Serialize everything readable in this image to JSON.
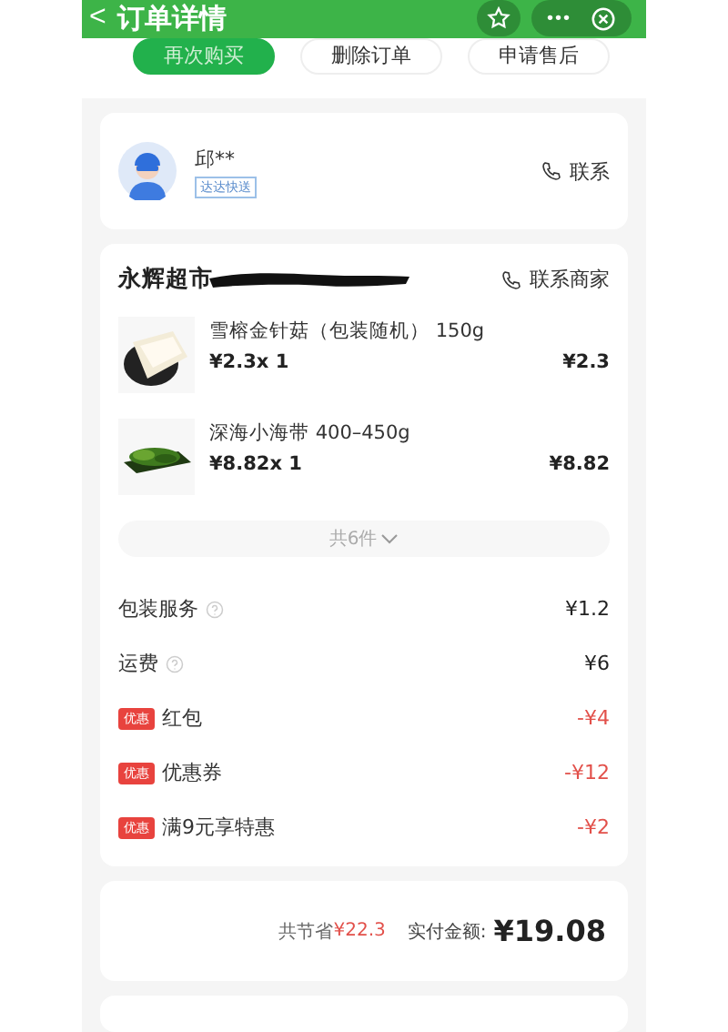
{
  "header": {
    "back": "<",
    "title": "订单详情",
    "more": "•••"
  },
  "actions": [
    {
      "label": "再次购买",
      "kind": "primary"
    },
    {
      "label": "删除订单",
      "kind": "plain"
    },
    {
      "label": "申请售后",
      "kind": "plain"
    }
  ],
  "courier": {
    "name": "邱**",
    "tag": "达达快送",
    "contact": "联系"
  },
  "store": {
    "name": "永辉超市",
    "redacted": true,
    "contact": "联系商家"
  },
  "items": [
    {
      "name": "雪榕金针菇（包装随机） 150g",
      "unit": "¥2.3x  1",
      "total": "¥2.3",
      "kind": "mushroom"
    },
    {
      "name": "深海小海带 400–450g",
      "unit": "¥8.82x  1",
      "total": "¥8.82",
      "kind": "seaweed"
    }
  ],
  "expand": "共6件",
  "fees": [
    {
      "kind": "info",
      "label": "包装服务",
      "amount": "¥1.2"
    },
    {
      "kind": "info",
      "label": "运费",
      "amount": "¥6"
    },
    {
      "kind": "discount",
      "badge": "优惠",
      "label": "红包",
      "amount": "-¥4"
    },
    {
      "kind": "discount",
      "badge": "优惠",
      "label": "优惠券",
      "amount": "-¥12"
    },
    {
      "kind": "discount",
      "badge": "优惠",
      "label": "满9元享特惠",
      "amount": "-¥2"
    }
  ],
  "summary": {
    "saved_label": "共节省",
    "saved": "¥22.3",
    "paid_label": "实付金额:",
    "paid": "¥19.08"
  }
}
